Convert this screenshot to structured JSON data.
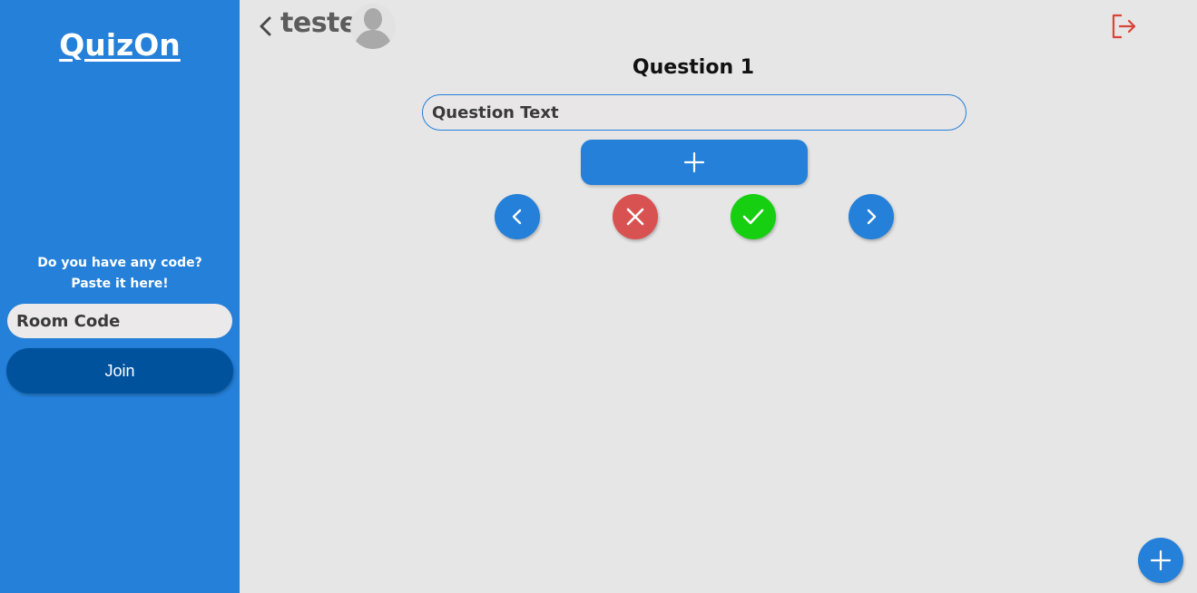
{
  "sidebar": {
    "brand": "QuizOn",
    "code_prompt_line1": "Do you have any code?",
    "code_prompt_line2": "Paste it here!",
    "room_code_placeholder": "Room Code",
    "join_label": "Join"
  },
  "header": {
    "quiz_title": "teste",
    "icons": [
      "chevron-left-icon",
      "avatar",
      "logout-icon"
    ]
  },
  "editor": {
    "question_heading": "Question 1",
    "question_text_placeholder": "Question Text",
    "icons": [
      "plus-icon",
      "chevron-left-icon",
      "close-icon",
      "check-icon",
      "chevron-right-icon"
    ]
  },
  "fab": {
    "icon": "plus-icon"
  },
  "colors": {
    "primary": "#2480d8",
    "join": "#00529d",
    "danger": "#d95252",
    "success": "#16cf10",
    "logout": "#d9443a",
    "background": "#e6e6e6"
  }
}
